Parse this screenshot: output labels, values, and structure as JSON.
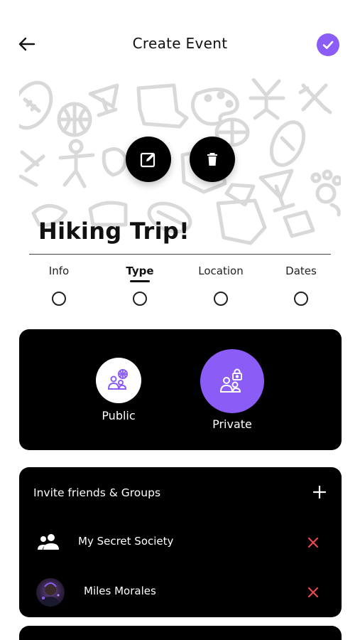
{
  "header": {
    "title": "Create Event",
    "back_icon": "arrow-left-icon",
    "confirm_icon": "check-circle-icon",
    "accent_color": "#8b5cf6"
  },
  "banner": {
    "background_icons": [
      "football-icon",
      "basketball-icon",
      "person-icon",
      "palette-icon",
      "cocktail-icon",
      "pawprint-icon",
      "map-icon"
    ],
    "edit_icon": "edit-icon",
    "delete_icon": "trash-icon"
  },
  "event": {
    "title": "Hiking Trip!"
  },
  "steps": [
    {
      "label": "Info",
      "active": false
    },
    {
      "label": "Type",
      "active": true
    },
    {
      "label": "Location",
      "active": false
    },
    {
      "label": "Dates",
      "active": false
    }
  ],
  "event_type": {
    "options": [
      {
        "label": "Public",
        "icon": "public-group-icon",
        "selected": false
      },
      {
        "label": "Private",
        "icon": "private-group-icon",
        "selected": true
      }
    ]
  },
  "invite": {
    "title": "Invite friends & Groups",
    "add_icon": "plus-icon",
    "items": [
      {
        "label": "My Secret Society",
        "icon": "group-icon"
      },
      {
        "label": "Miles Morales",
        "icon": "avatar"
      }
    ],
    "remove_icon": "close-icon",
    "remove_color": "#e5484d"
  }
}
